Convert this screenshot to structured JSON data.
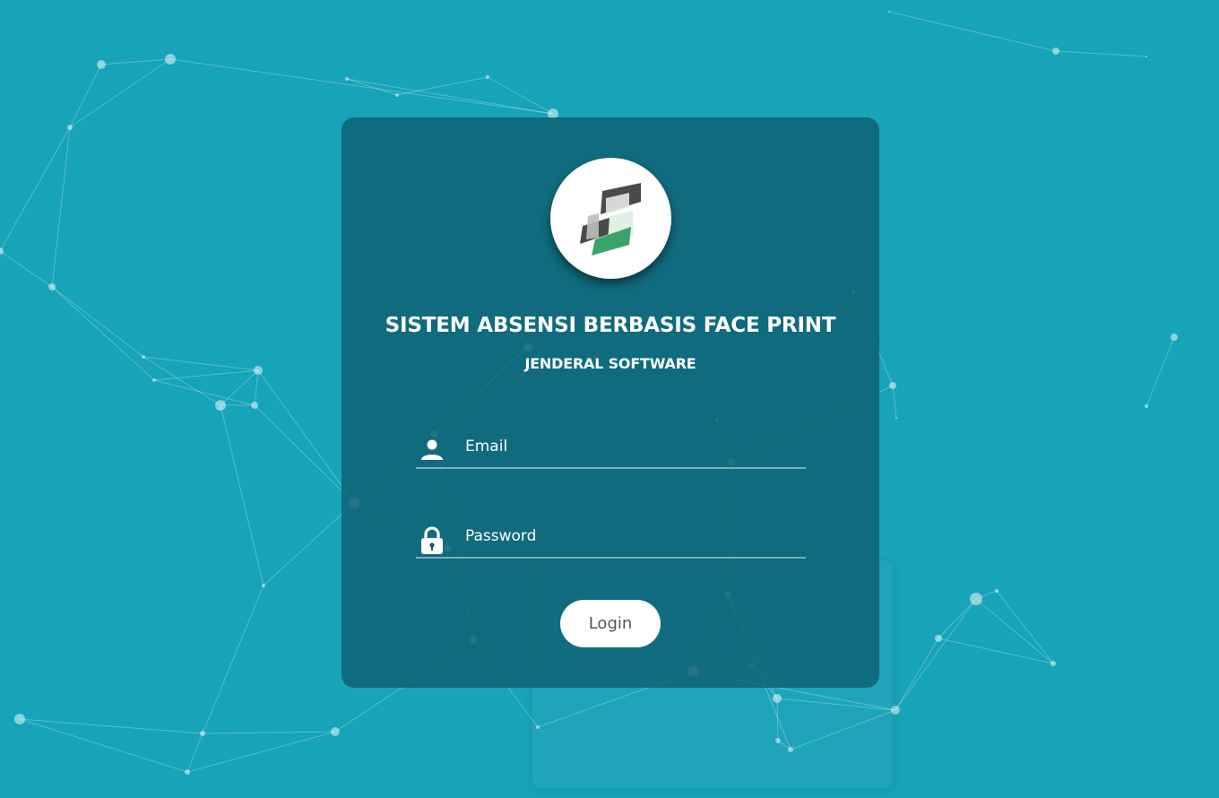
{
  "login": {
    "title": "SISTEM ABSENSI BERBASIS FACE PRINT",
    "subtitle": "JENDERAL SOFTWARE",
    "email_placeholder": "Email",
    "password_placeholder": "Password",
    "login_label": "Login"
  },
  "icons": {
    "email": "user-icon",
    "password": "lock-icon",
    "logo": "app-logo"
  },
  "colors": {
    "background": "#17a3b8",
    "card": "#0e5f70",
    "logo_dark": "#4a4a4a",
    "logo_green": "#3aa36a"
  }
}
